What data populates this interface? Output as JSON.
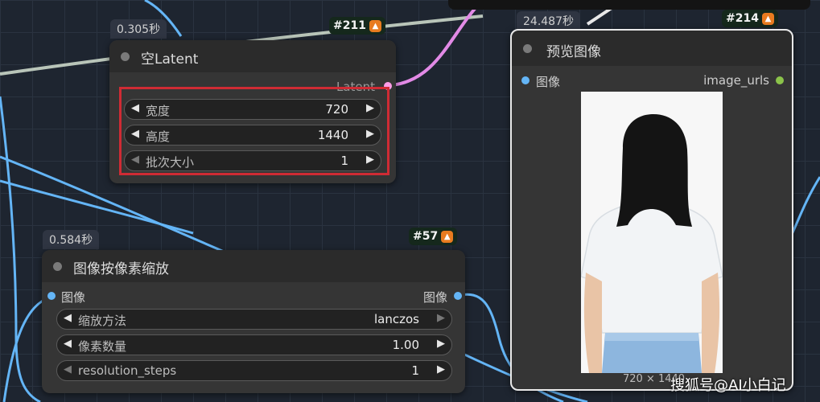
{
  "nodes": {
    "empty_latent": {
      "timer": "0.305秒",
      "badge": "#211",
      "title": "空Latent",
      "output_label": "Latent",
      "widgets": [
        {
          "label": "宽度",
          "value": "720"
        },
        {
          "label": "高度",
          "value": "1440"
        },
        {
          "label": "批次大小",
          "value": "1"
        }
      ]
    },
    "scale_node": {
      "timer": "0.584秒",
      "badge": "#57",
      "title": "图像按像素缩放",
      "input_label": "图像",
      "output_label": "图像",
      "widgets": [
        {
          "label": "缩放方法",
          "value": "lanczos"
        },
        {
          "label": "像素数量",
          "value": "1.00"
        },
        {
          "label": "resolution_steps",
          "value": "1"
        }
      ]
    },
    "preview": {
      "timer": "24.487秒",
      "badge": "#214",
      "title": "预览图像",
      "input_label": "图像",
      "output_label": "image_urls",
      "image_size": "720 × 1440"
    }
  },
  "icons": {
    "badge": "fox-icon",
    "status": "status-dot-icon",
    "arrow_left": "triangle-left-icon",
    "arrow_right": "triangle-right-icon"
  },
  "colors": {
    "canvas": "#1e2530",
    "node_body": "#353535",
    "node_header": "#2b2b2b",
    "highlight": "#cf2b34",
    "wire_image": "#64b5f6",
    "wire_latent": "#e57ee5",
    "badge": "#15281c"
  },
  "watermark": "搜狐号@AI小白记"
}
